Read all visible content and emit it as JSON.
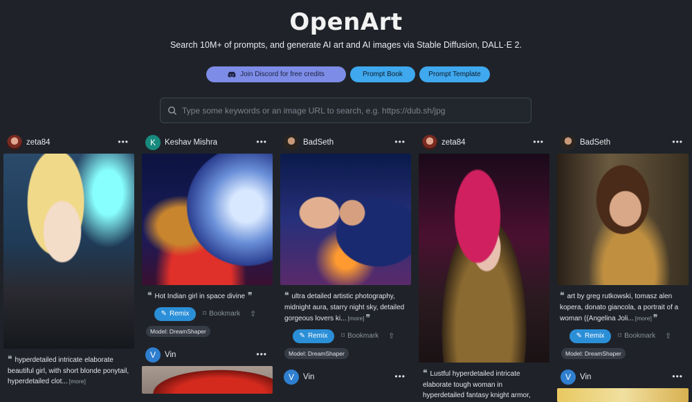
{
  "header": {
    "title": "OpenArt",
    "subtitle": "Search 10M+ of prompts, and generate AI art and AI images via Stable Diffusion, DALL·E 2.",
    "buttons": {
      "discord": "Join Discord for free credits",
      "prompt_book": "Prompt Book",
      "prompt_template": "Prompt Template"
    },
    "search_placeholder": "Type some keywords or an image URL to search, e.g. https://dub.sh/jpg"
  },
  "common": {
    "remix": "Remix",
    "bookmark": "Bookmark",
    "more": "[more]"
  },
  "colors": {
    "accent": "#2b8fd8",
    "discord": "#7d8ce6",
    "bg": "#1f2329"
  },
  "columns": [
    {
      "cards": [
        {
          "author": "zeta84",
          "caption": "hyperdetailed intricate elaborate beautiful girl, with short blonde ponytail, hyperdetailed clot...",
          "more": true
        }
      ]
    },
    {
      "cards": [
        {
          "author": "Keshav Mishra",
          "initial": "K",
          "caption": "Hot Indian girl in space divine",
          "model": "Model: DreamShaper"
        },
        {
          "author": "Vin",
          "initial": "V"
        }
      ]
    },
    {
      "cards": [
        {
          "author": "BadSeth",
          "caption": "ultra detailed artistic photography, midnight aura, starry night sky, detailed gorgeous lovers ki...",
          "more": true,
          "model": "Model: DreamShaper"
        },
        {
          "author": "Vin",
          "initial": "V"
        }
      ]
    },
    {
      "cards": [
        {
          "author": "zeta84",
          "caption": "Lustful hyperdetailed intricate elaborate tough woman in hyperdetailed fantasy knight armor,"
        }
      ]
    },
    {
      "cards": [
        {
          "author": "BadSeth",
          "caption": "art by greg rutkowski, tomasz alen kopera, donato giancola, a portrait of a woman ((Angelina Joli...",
          "more": true,
          "model": "Model: DreamShaper"
        },
        {
          "author": "Vin",
          "initial": "V"
        }
      ]
    }
  ]
}
